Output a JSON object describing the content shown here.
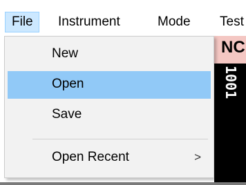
{
  "menubar": {
    "items": [
      {
        "label": "File"
      },
      {
        "label": "Instrument"
      },
      {
        "label": "Mode"
      },
      {
        "label": "Test"
      }
    ]
  },
  "background": {
    "header_text": "NC",
    "vertical_text": "1001",
    "header_color": "#f4c7c3"
  },
  "file_menu": {
    "items": [
      {
        "label": "New"
      },
      {
        "label": "Open"
      },
      {
        "label": "Save"
      },
      {
        "label": "Open Recent",
        "submenu_icon": "chevron-right-icon",
        "submenu_glyph": ">"
      }
    ],
    "highlight_color": "#91c9f7"
  }
}
